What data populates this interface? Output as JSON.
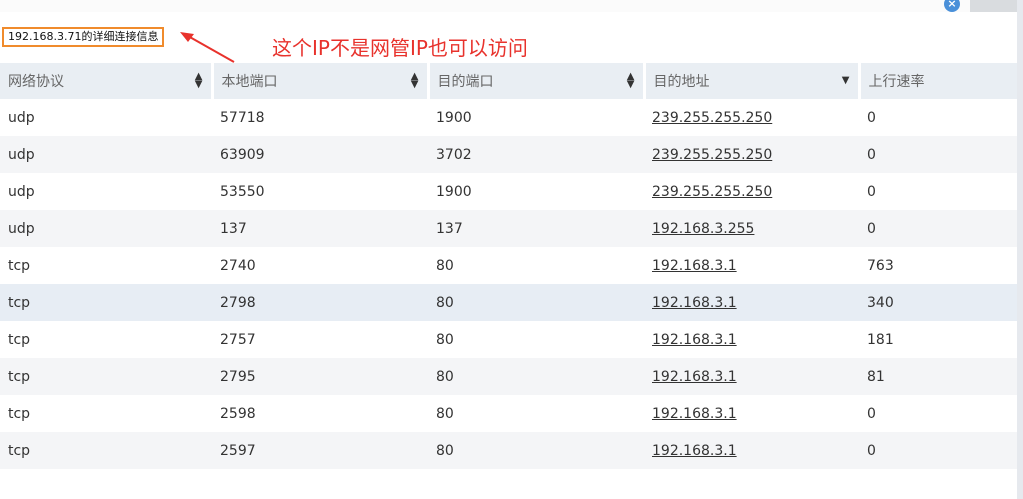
{
  "window": {
    "close_glyph": "×"
  },
  "title": "192.168.3.71的详细连接信息",
  "annotation": "这个IP不是网管IP也可以访问",
  "table": {
    "headers": [
      "网络协议",
      "本地端口",
      "目的端口",
      "目的地址",
      "上行速率"
    ],
    "rows": [
      {
        "protocol": "udp",
        "local_port": "57718",
        "dest_port": "1900",
        "dest_addr": "239.255.255.250",
        "up_rate": "0"
      },
      {
        "protocol": "udp",
        "local_port": "63909",
        "dest_port": "3702",
        "dest_addr": "239.255.255.250",
        "up_rate": "0"
      },
      {
        "protocol": "udp",
        "local_port": "53550",
        "dest_port": "1900",
        "dest_addr": "239.255.255.250",
        "up_rate": "0"
      },
      {
        "protocol": "udp",
        "local_port": "137",
        "dest_port": "137",
        "dest_addr": "192.168.3.255",
        "up_rate": "0"
      },
      {
        "protocol": "tcp",
        "local_port": "2740",
        "dest_port": "80",
        "dest_addr": "192.168.3.1",
        "up_rate": "763"
      },
      {
        "protocol": "tcp",
        "local_port": "2798",
        "dest_port": "80",
        "dest_addr": "192.168.3.1",
        "up_rate": "340"
      },
      {
        "protocol": "tcp",
        "local_port": "2757",
        "dest_port": "80",
        "dest_addr": "192.168.3.1",
        "up_rate": "181"
      },
      {
        "protocol": "tcp",
        "local_port": "2795",
        "dest_port": "80",
        "dest_addr": "192.168.3.1",
        "up_rate": "81"
      },
      {
        "protocol": "tcp",
        "local_port": "2598",
        "dest_port": "80",
        "dest_addr": "192.168.3.1",
        "up_rate": "0"
      },
      {
        "protocol": "tcp",
        "local_port": "2597",
        "dest_port": "80",
        "dest_addr": "192.168.3.1",
        "up_rate": "0"
      }
    ],
    "selected_row": 5
  },
  "colors": {
    "annotation": "#e8322c",
    "title_border": "#f08b2c",
    "header_bg": "#e9eef3",
    "close_button": "#4a90d9"
  },
  "icons": {
    "sort_both": "sort-icon",
    "sort_desc": "sort-desc-icon",
    "close": "close-icon",
    "arrow": "annotation-arrow-icon"
  }
}
